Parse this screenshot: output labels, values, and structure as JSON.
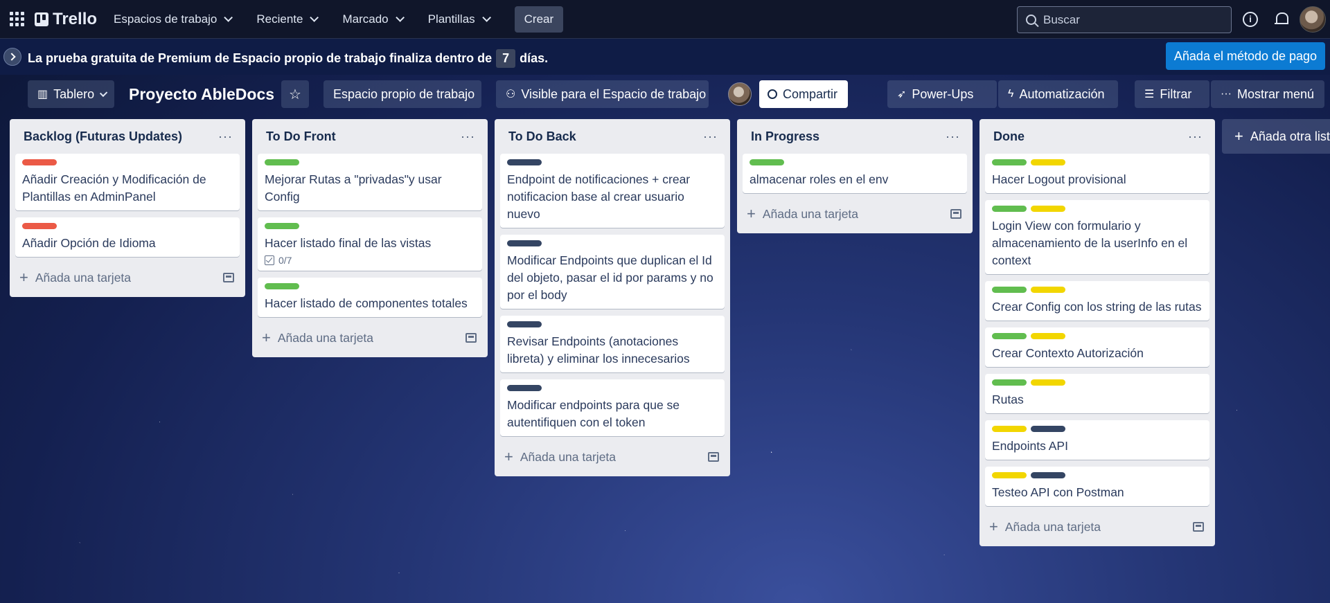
{
  "nav": {
    "logo": "Trello",
    "menu": [
      "Espacios de trabajo",
      "Reciente",
      "Marcado",
      "Plantillas"
    ],
    "create": "Crear",
    "search_placeholder": "Buscar"
  },
  "banner": {
    "text_before": "La prueba gratuita de Premium de Espacio propio de trabajo finaliza dentro de",
    "days": "7",
    "text_after": "días.",
    "pay_button": "Añada el método de pago"
  },
  "board": {
    "view": "Tablero",
    "title": "Proyecto AbleDocs",
    "workspace": "Espacio propio de trabajo",
    "visibility": "Visible para el Espacio de trabajo",
    "share": "Compartir",
    "powerups": "Power-Ups",
    "automation": "Automatización",
    "filter": "Filtrar",
    "show_menu": "Mostrar menú",
    "add_list": "Añada otra lista"
  },
  "colors": {
    "red": "#eb5a46",
    "green": "#61bd4f",
    "yellow": "#f2d600",
    "dark": "#344563"
  },
  "add_card_label": "Añada una tarjeta",
  "lists": [
    {
      "title": "Backlog (Futuras Updates)",
      "cards": [
        {
          "labels": [
            "red"
          ],
          "text": "Añadir Creación y Modificación de Plantillas en AdminPanel"
        },
        {
          "labels": [
            "red"
          ],
          "text": "Añadir Opción de Idioma"
        }
      ]
    },
    {
      "title": "To Do Front",
      "cards": [
        {
          "labels": [
            "green"
          ],
          "text": "Mejorar Rutas a \"privadas\"y usar Config"
        },
        {
          "labels": [
            "green"
          ],
          "text": "Hacer listado final de las vistas",
          "checklist": "0/7"
        },
        {
          "labels": [
            "green"
          ],
          "text": "Hacer listado de componentes totales"
        }
      ]
    },
    {
      "title": "To Do Back",
      "cards": [
        {
          "labels": [
            "dark"
          ],
          "text": "Endpoint de notificaciones + crear notificacion base al crear usuario nuevo"
        },
        {
          "labels": [
            "dark"
          ],
          "text": "Modificar Endpoints que duplican el Id del objeto, pasar el id por params y no por el body"
        },
        {
          "labels": [
            "dark"
          ],
          "text": "Revisar Endpoints (anotaciones libreta) y eliminar los innecesarios"
        },
        {
          "labels": [
            "dark"
          ],
          "text": "Modificar endpoints para que se autentifiquen con el token"
        }
      ]
    },
    {
      "title": "In Progress",
      "cards": [
        {
          "labels": [
            "green"
          ],
          "text": "almacenar roles en el env"
        }
      ]
    },
    {
      "title": "Done",
      "cards": [
        {
          "labels": [
            "green",
            "yellow"
          ],
          "text": "Hacer Logout provisional"
        },
        {
          "labels": [
            "green",
            "yellow"
          ],
          "text": "Login View con formulario y almacenamiento de la userInfo en el context"
        },
        {
          "labels": [
            "green",
            "yellow"
          ],
          "text": "Crear Config con los string de las rutas"
        },
        {
          "labels": [
            "green",
            "yellow"
          ],
          "text": "Crear Contexto Autorización"
        },
        {
          "labels": [
            "green",
            "yellow"
          ],
          "text": "Rutas"
        },
        {
          "labels": [
            "yellow",
            "dark"
          ],
          "text": "Endpoints API"
        },
        {
          "labels": [
            "yellow",
            "dark"
          ],
          "text": "Testeo API con Postman"
        }
      ]
    }
  ]
}
